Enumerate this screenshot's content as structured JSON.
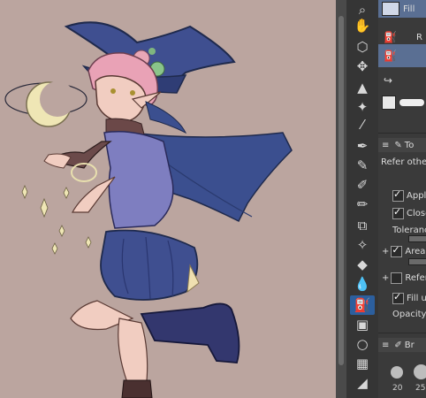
{
  "layers": {
    "fill_label": "Fill",
    "r_label": "R"
  },
  "tool_property": {
    "title": "To",
    "refer_label": "Refer other l",
    "apply_label": "Apply",
    "close_label": "Close",
    "tolerance_label": "Toleranc",
    "area_label": "Area",
    "refer2_label": "Refer",
    "fill_up_label": "Fill up",
    "opacity_label": "Opacity"
  },
  "brush_size": {
    "title": "Br",
    "sizes": [
      "20",
      "25"
    ]
  },
  "tools": [
    {
      "name": "search-icon",
      "glyph": "⌕"
    },
    {
      "name": "hand-icon",
      "glyph": "✋"
    },
    {
      "name": "object-cube-icon",
      "glyph": "⬡"
    },
    {
      "name": "move-icon",
      "glyph": "✥"
    },
    {
      "name": "auto-select-icon",
      "glyph": "▲"
    },
    {
      "name": "magic-wand-icon",
      "glyph": "✦"
    },
    {
      "name": "eyedropper-icon",
      "glyph": "⁄"
    },
    {
      "name": "pen-icon",
      "glyph": "✒"
    },
    {
      "name": "pencil-icon",
      "glyph": "✎"
    },
    {
      "name": "brush-icon",
      "glyph": "✐"
    },
    {
      "name": "marker-icon",
      "glyph": "✏"
    },
    {
      "name": "airbrush-icon",
      "glyph": "⧉"
    },
    {
      "name": "decoration-icon",
      "glyph": "✧"
    },
    {
      "name": "eraser-icon",
      "glyph": "◆"
    },
    {
      "name": "blend-icon",
      "glyph": "💧"
    },
    {
      "name": "fill-icon",
      "glyph": "⛽"
    },
    {
      "name": "gradient-icon",
      "glyph": "▣"
    },
    {
      "name": "shape-icon",
      "glyph": "○"
    },
    {
      "name": "frame-icon",
      "glyph": "▦"
    },
    {
      "name": "ruler-icon",
      "glyph": "◢"
    }
  ],
  "colors": {
    "canvas_bg": "#bba59f",
    "panel_bg": "#3a3a3a",
    "active_tool": "#2c5f9e",
    "selected_row": "#5a6f93",
    "hat": "#3e4f8e",
    "hair": "#e8a0b4"
  }
}
